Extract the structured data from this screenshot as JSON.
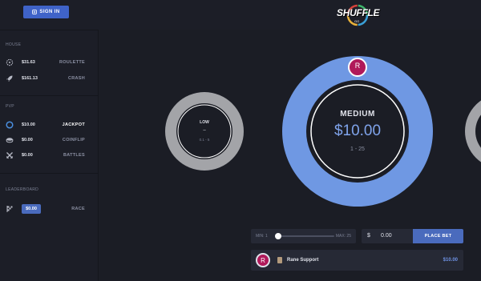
{
  "header": {
    "signin_label": "SIGN IN",
    "logo_text": "SHUFFLE",
    "logo_sub": "GG"
  },
  "sidebar": {
    "house_title": "HOUSE",
    "house_items": [
      {
        "amount": "$31.63",
        "label": "ROULETTE",
        "icon": "roulette-icon"
      },
      {
        "amount": "$161.13",
        "label": "CRASH",
        "icon": "rocket-icon"
      }
    ],
    "pvp_title": "PVP",
    "pvp_items": [
      {
        "amount": "$10.00",
        "label": "JACKPOT",
        "icon": "jackpot-ring-icon",
        "active": true
      },
      {
        "amount": "$0.00",
        "label": "COINFLIP",
        "icon": "coin-icon"
      },
      {
        "amount": "$0.00",
        "label": "BATTLES",
        "icon": "swords-icon"
      }
    ],
    "leaderboard_title": "LEADERBOARD",
    "race": {
      "amount": "$0.00",
      "label": "RACE",
      "icon": "race-flag-icon"
    }
  },
  "jackpots": {
    "low": {
      "title": "LOW",
      "amount": "–",
      "range": "0.1 - 5"
    },
    "medium": {
      "title": "MEDIUM",
      "amount": "$10.00",
      "range": "1 - 25",
      "avatar_initial": "R"
    }
  },
  "bet": {
    "min_label": "MIN: 1",
    "max_label": "MAX: 25",
    "slider_value_fraction": 0.0,
    "currency": "$",
    "amount": "0.00",
    "place_bet_label": "PLACE BET"
  },
  "players": [
    {
      "initial": "R",
      "name": "Rane Support",
      "amount": "$10.00"
    }
  ],
  "colors": {
    "accent": "#4a6bbd",
    "ring_medium": "#6f98e3",
    "ring_low": "#a3a4a8",
    "avatar": "#b0195a",
    "background": "#1b1d25"
  }
}
